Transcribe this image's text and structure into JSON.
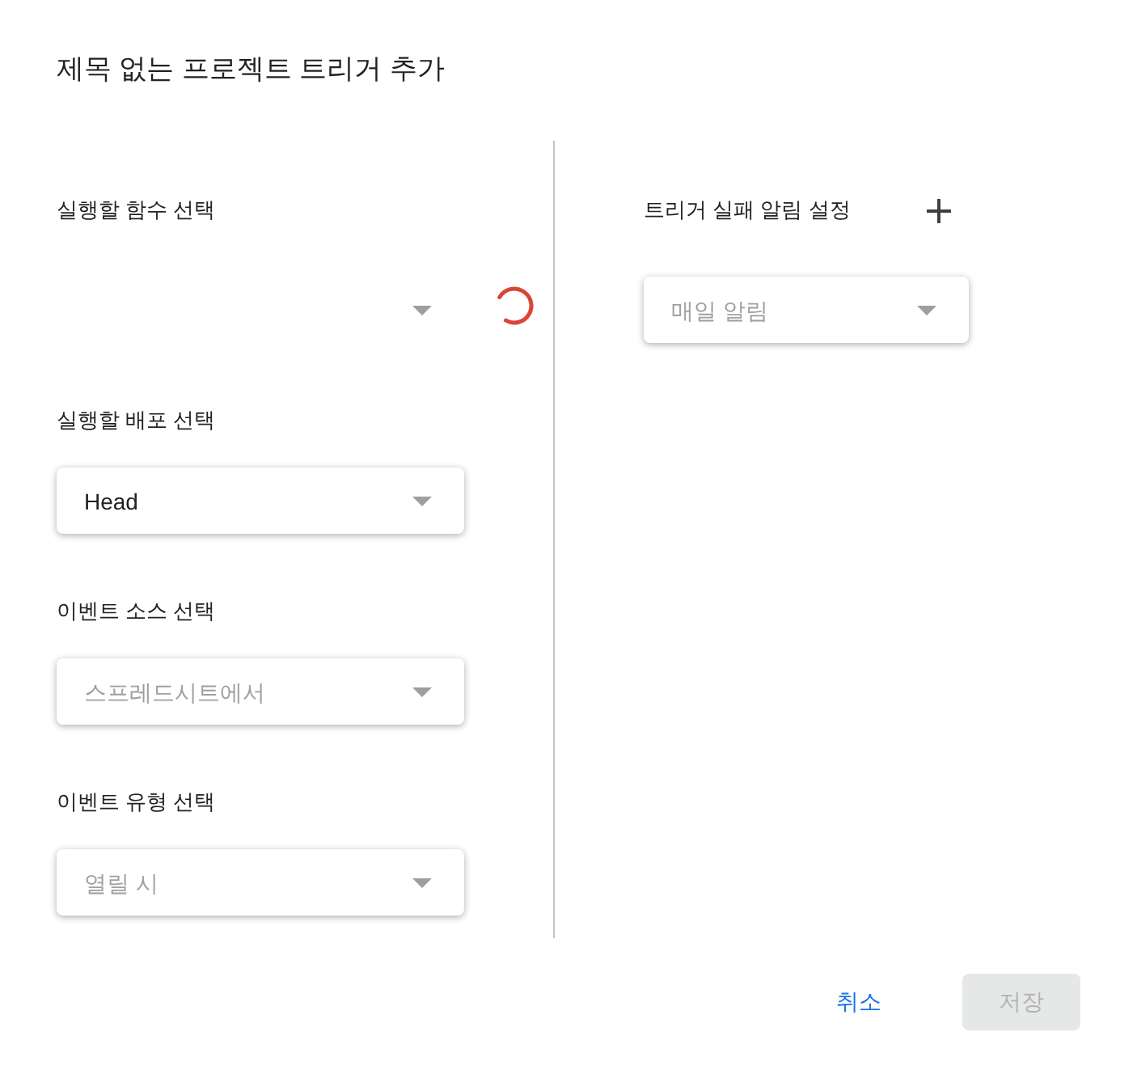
{
  "dialog": {
    "title": "제목 없는 프로젝트 트리거 추가"
  },
  "fields": [
    {
      "label": "실행할 함수 선택",
      "loading": true
    },
    {
      "label": "실행할 배포 선택",
      "value": "Head",
      "loading": false,
      "disabled": false
    },
    {
      "label": "이벤트 소스 선택",
      "value": "스프레드시트에서",
      "loading": false,
      "disabled": true
    },
    {
      "label": "이벤트 유형 선택",
      "value": "열릴 시",
      "loading": false,
      "disabled": true
    }
  ],
  "failure_notification": {
    "label": "트리거 실패 알림 설정",
    "value": "매일 알림",
    "disabled": true
  },
  "buttons": [
    {
      "label": "취소",
      "kind": "text",
      "disabled": false
    },
    {
      "label": "저장",
      "kind": "filled",
      "disabled": true
    }
  ]
}
